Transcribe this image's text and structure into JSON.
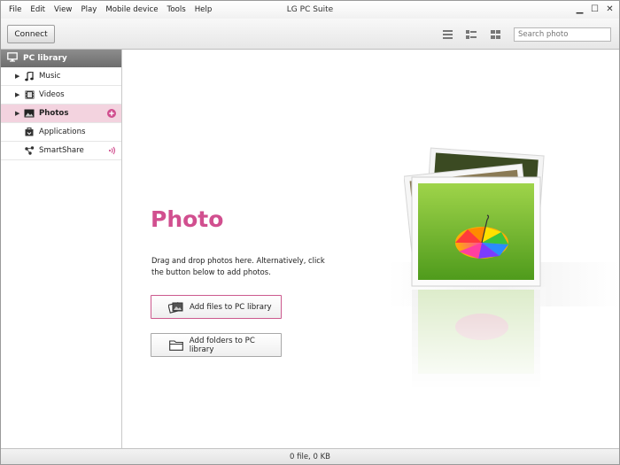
{
  "window": {
    "title": "LG PC Suite"
  },
  "menu": [
    "File",
    "Edit",
    "View",
    "Play",
    "Mobile device",
    "Tools",
    "Help"
  ],
  "window_controls": {
    "minimize": "▁",
    "maximize": "☐",
    "close": "✕"
  },
  "toolbar": {
    "connect_label": "Connect",
    "search_placeholder": "Search photo"
  },
  "sidebar": {
    "header": "PC library",
    "items": [
      {
        "label": "Music",
        "icon": "music-icon"
      },
      {
        "label": "Videos",
        "icon": "video-icon"
      },
      {
        "label": "Photos",
        "icon": "photo-icon",
        "active": true
      },
      {
        "label": "Applications",
        "icon": "applications-icon"
      },
      {
        "label": "SmartShare",
        "icon": "smartshare-icon"
      }
    ]
  },
  "main": {
    "heading": "Photo",
    "description": "Drag and drop photos here. Alternatively, click the button below to add photos.",
    "add_files_label": "Add files to PC library",
    "add_folders_label": "Add folders to PC library"
  },
  "status": {
    "text": "0 file, 0 KB"
  },
  "colors": {
    "accent": "#d14f8f",
    "active_row": "#f3d3df",
    "sidebar_header": "#7a7a7a"
  }
}
